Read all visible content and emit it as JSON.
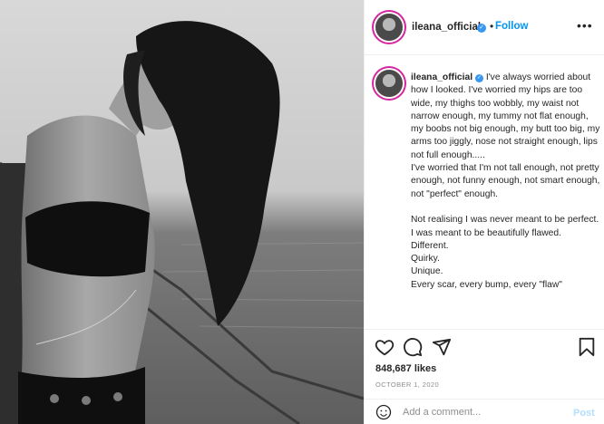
{
  "post": {
    "image_alt": "black and white photo of a woman in a bikini on a boat"
  },
  "header": {
    "username": "ileana_official",
    "verified_glyph": "✓",
    "separator": "•",
    "follow_label": "Follow",
    "more_label": "•••"
  },
  "caption": {
    "username": "ileana_official",
    "verified_glyph": "✓",
    "text": " I've always worried about how I looked. I've worried my hips are too wide, my thighs too wobbly, my waist not narrow enough, my tummy not flat enough, my boobs not big enough, my butt too big, my arms too jiggly, nose not straight enough, lips not full enough.....\nI've worried that I'm not tall enough, not pretty enough, not funny enough, not smart enough, not \"perfect\" enough.\n\nNot realising I was never meant to be perfect. I was meant to be beautifully flawed.\nDifferent.\nQuirky.\nUnique.\nEvery scar, every bump, every \"flaw\""
  },
  "actions": {
    "icons": [
      "heart-icon",
      "comment-icon",
      "share-icon",
      "bookmark-icon"
    ],
    "likes": "848,687 likes",
    "date": "OCTOBER 1, 2020"
  },
  "comment": {
    "placeholder": "Add a comment...",
    "post_label": "Post"
  },
  "colors": {
    "accent": "#0095f6",
    "post_disabled": "#b2dffc",
    "verified": "#3897f0",
    "border": "#efefef",
    "muted": "#8e8e8e"
  }
}
